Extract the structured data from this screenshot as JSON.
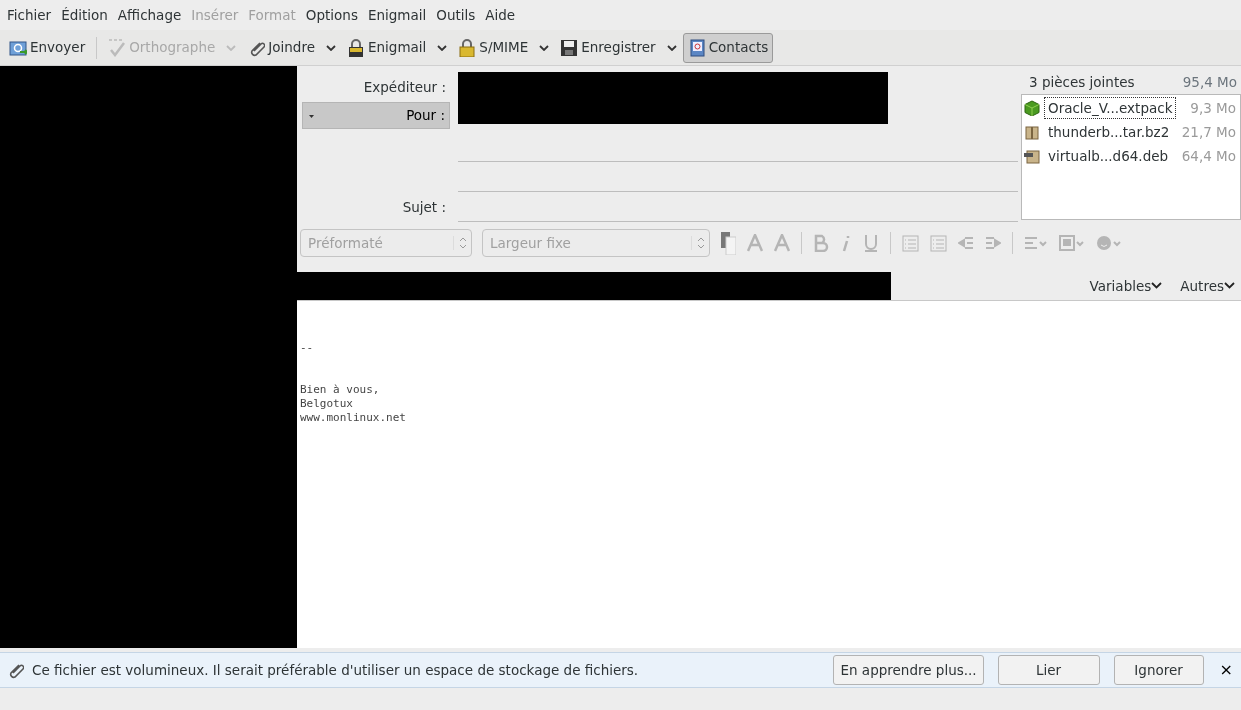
{
  "menu": [
    {
      "label": "Fichier",
      "disabled": false
    },
    {
      "label": "Édition",
      "disabled": false
    },
    {
      "label": "Affichage",
      "disabled": false
    },
    {
      "label": "Insérer",
      "disabled": true
    },
    {
      "label": "Format",
      "disabled": true
    },
    {
      "label": "Options",
      "disabled": false
    },
    {
      "label": "Enigmail",
      "disabled": false
    },
    {
      "label": "Outils",
      "disabled": false
    },
    {
      "label": "Aide",
      "disabled": false
    }
  ],
  "toolbar": [
    {
      "kind": "send",
      "label": "Envoyer",
      "disabled": false,
      "dropdown": false,
      "pressed": false
    },
    {
      "kind": "spell",
      "label": "Orthographe",
      "disabled": true,
      "dropdown": true,
      "pressed": false
    },
    {
      "kind": "attach",
      "label": "Joindre",
      "disabled": false,
      "dropdown": true,
      "pressed": false
    },
    {
      "kind": "pgp",
      "label": "Enigmail",
      "disabled": false,
      "dropdown": true,
      "pressed": false
    },
    {
      "kind": "lock",
      "label": "S/MIME",
      "disabled": false,
      "dropdown": true,
      "pressed": false
    },
    {
      "kind": "save",
      "label": "Enregistrer",
      "disabled": false,
      "dropdown": true,
      "pressed": false
    },
    {
      "kind": "contacts",
      "label": "Contacts",
      "disabled": false,
      "dropdown": false,
      "pressed": true
    }
  ],
  "header": {
    "from_label": "Expéditeur :",
    "to_label": "Pour :",
    "subject_label": "Sujet :"
  },
  "attachments": {
    "summary": "3 pièces jointes",
    "total": "95,4 Mo",
    "items": [
      {
        "kind": "box",
        "name": "Oracle_V...extpack",
        "size": "9,3 Mo",
        "selected": true
      },
      {
        "kind": "archive",
        "name": "thunderb...tar.bz2",
        "size": "21,7 Mo",
        "selected": false
      },
      {
        "kind": "deb",
        "name": "virtualb...d64.deb",
        "size": "64,4 Mo",
        "selected": false
      }
    ]
  },
  "format": {
    "paragraph": "Préformaté",
    "font": "Largeur fixe",
    "disabled": true
  },
  "extras": [
    "Variables",
    "Autres"
  ],
  "body": {
    "separator": "--",
    "lines": [
      "Bien à vous,",
      "Belgotux",
      "www.monlinux.net"
    ]
  },
  "notification": {
    "message": "Ce fichier est volumineux. Il serait préférable d'utiliser un espace de stockage de fichiers.",
    "buttons": [
      "En apprendre plus...",
      "Lier",
      "Ignorer"
    ],
    "close": "×"
  }
}
